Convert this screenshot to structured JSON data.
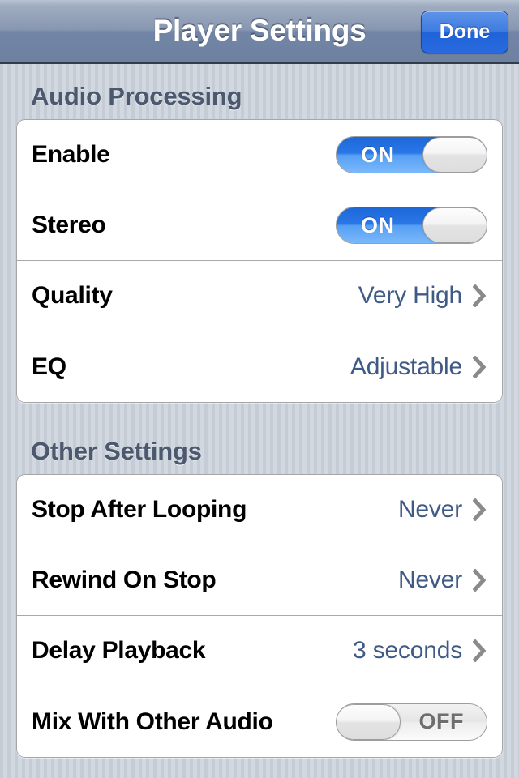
{
  "navbar": {
    "title": "Player Settings",
    "done_label": "Done",
    "accent_color": "#2a6ade"
  },
  "sections": [
    {
      "header": "Audio Processing",
      "rows": [
        {
          "label": "Enable",
          "control": "toggle",
          "state": "ON"
        },
        {
          "label": "Stereo",
          "control": "toggle",
          "state": "ON"
        },
        {
          "label": "Quality",
          "control": "disclosure",
          "value": "Very High"
        },
        {
          "label": "EQ",
          "control": "disclosure",
          "value": "Adjustable"
        }
      ]
    },
    {
      "header": "Other Settings",
      "rows": [
        {
          "label": "Stop After Looping",
          "control": "disclosure",
          "value": "Never"
        },
        {
          "label": "Rewind On Stop",
          "control": "disclosure",
          "value": "Never"
        },
        {
          "label": "Delay Playback",
          "control": "disclosure",
          "value": "3 seconds"
        },
        {
          "label": "Mix With Other Audio",
          "control": "toggle",
          "state": "OFF"
        }
      ]
    }
  ],
  "colors": {
    "value_text": "#3f5a85",
    "header_text": "#4b586e",
    "chevron": "#8a8a8a",
    "toggle_on": "#2a77e8",
    "background": "#c9cfd8"
  }
}
